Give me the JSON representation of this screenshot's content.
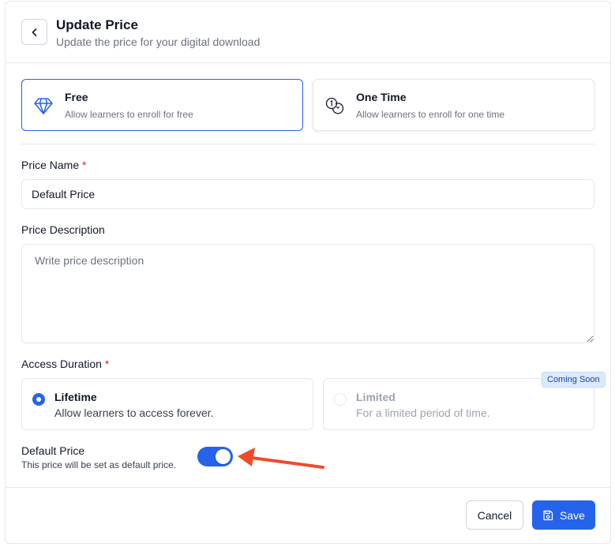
{
  "header": {
    "title": "Update Price",
    "subtitle": "Update the price for your digital download",
    "back_icon": "chevron-left-icon"
  },
  "price_types": [
    {
      "label": "Free",
      "description": "Allow learners to enroll for free",
      "icon": "diamond-icon",
      "selected": true
    },
    {
      "label": "One Time",
      "description": "Allow learners to enroll for one time",
      "icon": "one-time-payment-icon",
      "selected": false
    }
  ],
  "price_name": {
    "label": "Price Name",
    "required_mark": "*",
    "value": "Default Price"
  },
  "price_description": {
    "label": "Price Description",
    "placeholder": "Write price description",
    "value": ""
  },
  "access_duration": {
    "label": "Access Duration",
    "required_mark": "*",
    "options": [
      {
        "label": "Lifetime",
        "description": "Allow learners to access forever.",
        "checked": true,
        "disabled": false
      },
      {
        "label": "Limited",
        "description": "For a limited period of time.",
        "checked": false,
        "disabled": true,
        "badge": "Coming Soon"
      }
    ]
  },
  "default_price": {
    "title": "Default Price",
    "description": "This price will be set as default price.",
    "enabled": true
  },
  "footer": {
    "cancel_label": "Cancel",
    "save_label": "Save",
    "save_icon": "floppy-disk-icon"
  },
  "colors": {
    "primary": "#2563eb",
    "required": "#dc2626",
    "annotation_arrow": "#ef4b2b",
    "badge_bg": "#dbeafe"
  }
}
